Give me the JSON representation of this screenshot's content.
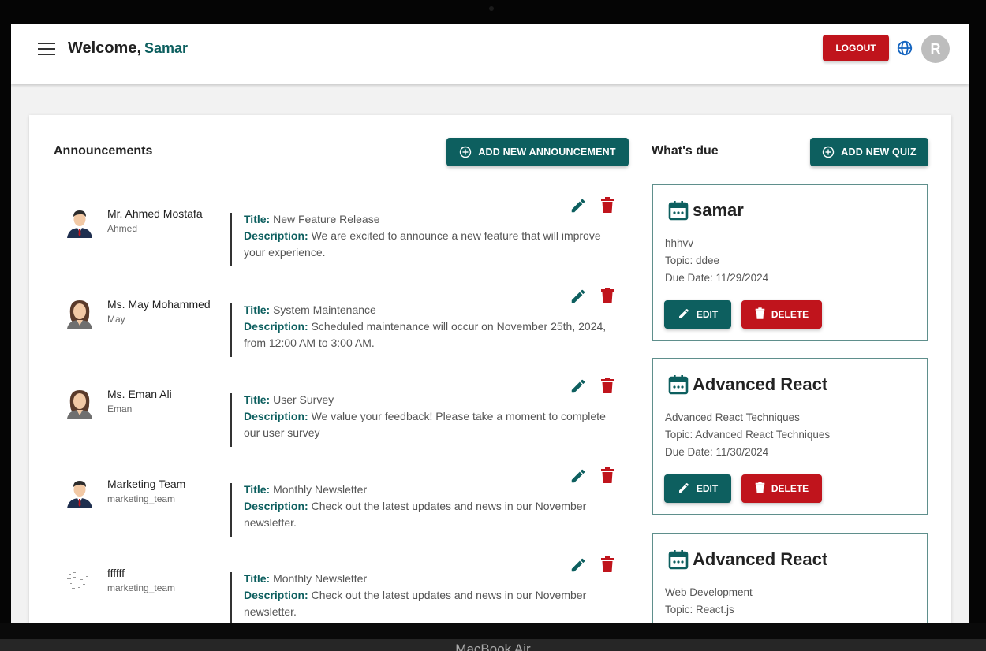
{
  "device_label": "MacBook Air",
  "header": {
    "welcome_text": "Welcome,",
    "user_name": "Samar",
    "logout_label": "LOGOUT",
    "avatar_initial": "R"
  },
  "announcements": {
    "title": "Announcements",
    "add_button_label": "ADD NEW ANNOUNCEMENT",
    "title_label": "Title:",
    "description_label": "Description:",
    "items": [
      {
        "name": "Mr. Ahmed Mostafa",
        "username": "Ahmed",
        "title": "New Feature Release",
        "description": "We are excited to announce a new feature that will improve your experience.",
        "avatar": "male-avatar-icon"
      },
      {
        "name": "Ms. May Mohammed",
        "username": "May",
        "title": "System Maintenance",
        "description": "Scheduled maintenance will occur on November 25th, 2024, from 12:00 AM to 3:00 AM.",
        "avatar": "female-avatar-icon"
      },
      {
        "name": "Ms. Eman Ali",
        "username": "Eman",
        "title": "User Survey",
        "description": "We value your feedback! Please take a moment to complete our user survey",
        "avatar": "female-avatar-icon"
      },
      {
        "name": "Marketing Team",
        "username": "marketing_team",
        "title": "Monthly Newsletter",
        "description": "Check out the latest updates and news in our November newsletter.",
        "avatar": "male-avatar-icon"
      },
      {
        "name": "ffffff",
        "username": "marketing_team",
        "title": "Monthly Newsletter",
        "description": "Check out the latest updates and news in our November newsletter.",
        "avatar": "broken-image-icon"
      }
    ]
  },
  "due": {
    "title": "What's due",
    "add_button_label": "ADD NEW QUIZ",
    "edit_label": "EDIT",
    "delete_label": "DELETE",
    "quizzes": [
      {
        "title": "samar",
        "description": "hhhvv",
        "topic": "Topic: ddee",
        "due_date": "Due Date: 11/29/2024"
      },
      {
        "title": "Advanced React",
        "description": "Advanced React Techniques",
        "topic": "Topic: Advanced React Techniques",
        "due_date": "Due Date: 11/30/2024"
      },
      {
        "title": "Advanced React",
        "description": "Web Development",
        "topic": "Topic: React.js",
        "due_date": ""
      }
    ]
  },
  "colors": {
    "teal": "#0d5f5f",
    "red": "#c0141c",
    "quiz_border": "#5f8f8c"
  }
}
